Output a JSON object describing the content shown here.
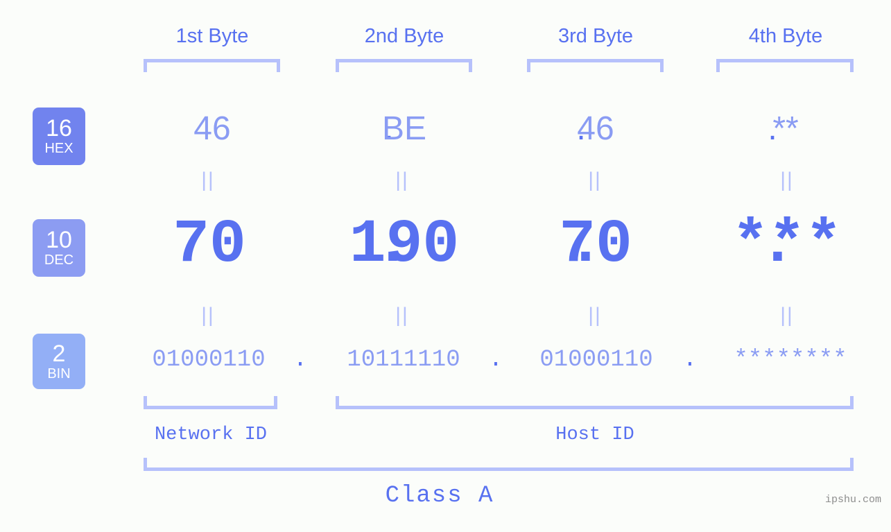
{
  "meta": {
    "watermark": "ipshu.com",
    "accent_color": "#5871f0",
    "accent_light_color": "#8a9cf3",
    "bracket_color": "#b6c1fb",
    "background_color": "#fbfdfa"
  },
  "byte_headers": [
    {
      "label": "1st Byte"
    },
    {
      "label": "2nd Byte"
    },
    {
      "label": "3rd Byte"
    },
    {
      "label": "4th Byte"
    }
  ],
  "bases": [
    {
      "number": "16",
      "name": "HEX",
      "color": "#7183ee"
    },
    {
      "number": "10",
      "name": "DEC",
      "color": "#8c9cf2"
    },
    {
      "number": "2",
      "name": "BIN",
      "color": "#93aff6"
    }
  ],
  "rows": {
    "hex": {
      "values": [
        "46",
        "BE",
        "46",
        "**"
      ],
      "separator": "."
    },
    "dec": {
      "values": [
        "70",
        "190",
        "70",
        "***"
      ],
      "separator": "."
    },
    "bin": {
      "values": [
        "01000110",
        "10111110",
        "01000110",
        "********"
      ],
      "separator": "."
    }
  },
  "equals_marks": [
    "||",
    "||",
    "||",
    "||"
  ],
  "sections": [
    {
      "label": "Network ID"
    },
    {
      "label": "Host ID"
    }
  ],
  "class": {
    "label": "Class A"
  }
}
